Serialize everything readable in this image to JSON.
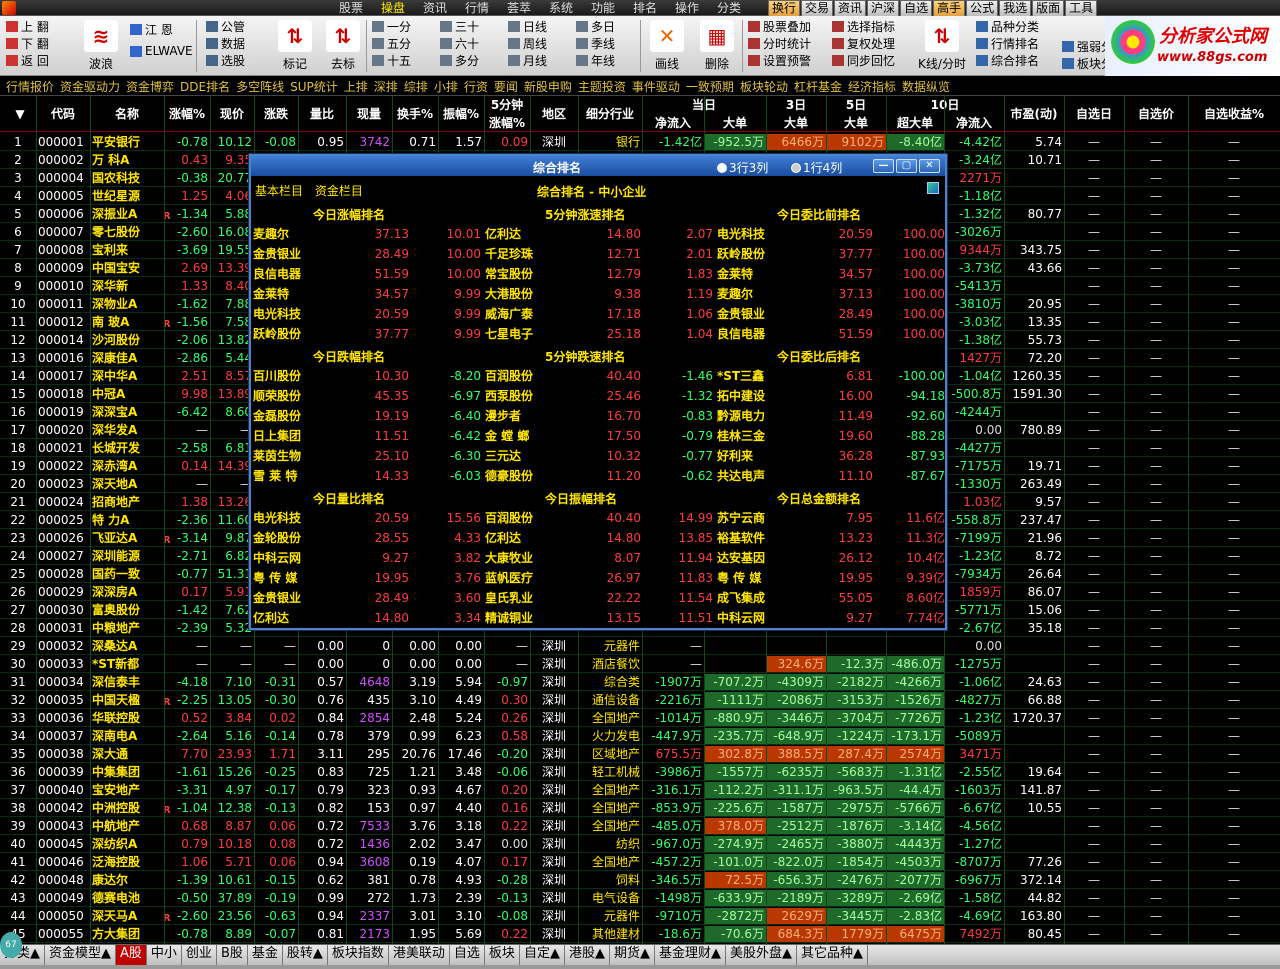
{
  "menu": {
    "items": [
      "股票",
      "操盘",
      "资讯",
      "行情",
      "荟萃",
      "系统",
      "功能",
      "排名",
      "操作",
      "分类"
    ],
    "active": 1,
    "quick": [
      "换行",
      "交易",
      "资讯",
      "沪深",
      "自选",
      "高手",
      "公式",
      "我选",
      "版面",
      "工具"
    ]
  },
  "toolbar": {
    "col1": [
      "上 翻",
      "下 翻",
      "返 回"
    ],
    "big": [
      {
        "label": "波浪",
        "icon": "≋"
      },
      {
        "label": "标记",
        "icon": "⇅"
      },
      {
        "label": "去标",
        "icon": "⇅"
      },
      {
        "label": "画线",
        "icon": "✕"
      },
      {
        "label": "删除",
        "icon": "▦"
      }
    ],
    "elwave": [
      "江 恩",
      "ELWAVE"
    ],
    "col_data": [
      "公管",
      "数据",
      "选股"
    ],
    "periods": [
      [
        "一分",
        "三十",
        "日线",
        "多日"
      ],
      [
        "五分",
        "六十",
        "周线",
        "季线"
      ],
      [
        "十五",
        "多分",
        "月线",
        "年线"
      ]
    ],
    "tools": [
      "股票叠加",
      "分时统计",
      "设置预警"
    ],
    "tools2": [
      "选择指标",
      "复权处理",
      "同步回忆"
    ],
    "kline": "K线/分时",
    "tools3": [
      "品种分类",
      "行情排名",
      "综合排名"
    ],
    "tools4": [
      "强弱分析",
      "板块分析"
    ]
  },
  "logo": {
    "title": "分析家公式网",
    "url": "www.88gs.com"
  },
  "catnav": [
    "行情报价",
    "资金驱动力",
    "资金博弈",
    "DDE排名",
    "多空阵线",
    "SUP统计",
    "上排",
    "深排",
    "综排",
    "小排",
    "行资",
    "要闻",
    "新股申购",
    "主题投资",
    "事件驱动",
    "一致预期",
    "板块轮动",
    "杠杆基金",
    "经济指标",
    "数据纵览"
  ],
  "columns": [
    "代码",
    "名称",
    "涨幅%",
    "现价",
    "涨跌",
    "量比",
    "现量",
    "换手%",
    "振幅%",
    "5分钟涨幅%",
    "地区",
    "细分行业",
    "当日净流入",
    "大单",
    "3日大单",
    "5日大单",
    "10日超大单",
    "10日净流入",
    "市盈(动)",
    "自选日",
    "自选价",
    "自选收益%"
  ],
  "col_groups": {
    "day": "当日",
    "d3": "3日",
    "d5": "5日",
    "d10": "10日",
    "m5a": "5分钟",
    "m5b": "涨幅%",
    "flow": "净流入",
    "big": "大单",
    "xbig": "超大单"
  },
  "rows": [
    [
      "1",
      "000001",
      "平安银行",
      "-0.78",
      "10.12",
      "-0.08",
      "0.95",
      "3742",
      "0.71",
      "1.57",
      "0.09",
      "深圳",
      "银行",
      "-1.42亿",
      "-952.5万",
      "6466万",
      "9102万",
      "-8.40亿",
      "-4.42亿",
      "5.74"
    ],
    [
      "2",
      "000002",
      "万 科A",
      "0.43",
      "9.35",
      "",
      "",
      "",
      "",
      "",
      "",
      "",
      "",
      "",
      "",
      "",
      "",
      "",
      "-3.24亿",
      "10.71"
    ],
    [
      "3",
      "000004",
      "国农科技",
      "-0.38",
      "20.77",
      "",
      "",
      "",
      "",
      "",
      "",
      "",
      "",
      "",
      "",
      "",
      "",
      "",
      "2271万",
      ""
    ],
    [
      "4",
      "000005",
      "世纪星源",
      "1.25",
      "4.06",
      "",
      "",
      "",
      "",
      "",
      "",
      "",
      "",
      "",
      "",
      "",
      "",
      "",
      "-1.18亿",
      ""
    ],
    [
      "5",
      "000006",
      "深振业A",
      "-1.34",
      "5.88",
      "",
      "",
      "",
      "",
      "",
      "",
      "",
      "",
      "",
      "",
      "",
      "",
      "",
      "-1.32亿",
      "80.77"
    ],
    [
      "6",
      "000007",
      "零七股份",
      "-2.60",
      "16.08",
      "",
      "",
      "",
      "",
      "",
      "",
      "",
      "",
      "",
      "",
      "",
      "",
      "",
      "-3026万",
      ""
    ],
    [
      "7",
      "000008",
      "宝利来",
      "-3.69",
      "19.55",
      "",
      "",
      "",
      "",
      "",
      "",
      "",
      "",
      "",
      "",
      "",
      "",
      "",
      "9344万",
      "343.75"
    ],
    [
      "8",
      "000009",
      "中国宝安",
      "2.69",
      "13.39",
      "",
      "",
      "",
      "",
      "",
      "",
      "",
      "",
      "",
      "",
      "",
      "",
      "",
      "-3.73亿",
      "43.66"
    ],
    [
      "9",
      "000010",
      "深华新",
      "1.33",
      "8.40",
      "",
      "",
      "",
      "",
      "",
      "",
      "",
      "",
      "",
      "",
      "",
      "",
      "",
      "-5413万",
      ""
    ],
    [
      "10",
      "000011",
      "深物业A",
      "-1.62",
      "7.88",
      "",
      "",
      "",
      "",
      "",
      "",
      "",
      "",
      "",
      "",
      "",
      "",
      "",
      "-3810万",
      "20.95"
    ],
    [
      "11",
      "000012",
      "南 玻A",
      "-1.56",
      "7.58",
      "",
      "",
      "",
      "",
      "",
      "",
      "",
      "",
      "",
      "",
      "",
      "",
      "",
      "-3.03亿",
      "13.35"
    ],
    [
      "12",
      "000014",
      "沙河股份",
      "-2.06",
      "13.82",
      "",
      "",
      "",
      "",
      "",
      "",
      "",
      "",
      "",
      "",
      "",
      "",
      "",
      "-1.38亿",
      "55.73"
    ],
    [
      "13",
      "000016",
      "深康佳A",
      "-2.86",
      "5.44",
      "",
      "",
      "",
      "",
      "",
      "",
      "",
      "",
      "",
      "",
      "",
      "",
      "",
      "1427万",
      "72.20"
    ],
    [
      "14",
      "000017",
      "深中华A",
      "2.51",
      "8.57",
      "",
      "",
      "",
      "",
      "",
      "",
      "",
      "",
      "",
      "",
      "",
      "",
      "",
      "-1.04亿",
      "1260.35"
    ],
    [
      "15",
      "000018",
      "中冠A",
      "9.98",
      "13.89",
      "",
      "",
      "",
      "",
      "",
      "",
      "",
      "",
      "",
      "",
      "",
      "",
      "",
      "-500.8万",
      "1591.30"
    ],
    [
      "16",
      "000019",
      "深深宝A",
      "-6.42",
      "8.60",
      "",
      "",
      "",
      "",
      "",
      "",
      "",
      "",
      "",
      "",
      "",
      "",
      "",
      "-4244万",
      ""
    ],
    [
      "17",
      "000020",
      "深华发A",
      "—",
      "—",
      "",
      "",
      "",
      "",
      "",
      "",
      "",
      "",
      "",
      "",
      "",
      "",
      "",
      "0.00",
      "780.89"
    ],
    [
      "18",
      "000021",
      "长城开发",
      "-2.58",
      "6.81",
      "",
      "",
      "",
      "",
      "",
      "",
      "",
      "",
      "",
      "",
      "",
      "",
      "",
      "-4427万",
      ""
    ],
    [
      "19",
      "000022",
      "深赤湾A",
      "0.14",
      "14.39",
      "",
      "",
      "",
      "",
      "",
      "",
      "",
      "",
      "",
      "",
      "",
      "",
      "",
      "-7175万",
      "19.71"
    ],
    [
      "20",
      "000023",
      "深天地A",
      "—",
      "—",
      "",
      "",
      "",
      "",
      "",
      "",
      "",
      "",
      "",
      "",
      "",
      "",
      "",
      "-1330万",
      "263.49"
    ],
    [
      "21",
      "000024",
      "招商地产",
      "1.38",
      "13.26",
      "",
      "",
      "",
      "",
      "",
      "",
      "",
      "",
      "",
      "",
      "",
      "",
      "",
      "1.03亿",
      "9.57"
    ],
    [
      "22",
      "000025",
      "特 力A",
      "-2.36",
      "11.60",
      "",
      "",
      "",
      "",
      "",
      "",
      "",
      "",
      "",
      "",
      "",
      "",
      "",
      "-558.8万",
      "237.47"
    ],
    [
      "23",
      "000026",
      "飞亚达A",
      "-3.14",
      "9.87",
      "",
      "",
      "",
      "",
      "",
      "",
      "",
      "",
      "",
      "",
      "",
      "",
      "",
      "-7199万",
      "21.96"
    ],
    [
      "24",
      "000027",
      "深圳能源",
      "-2.71",
      "6.82",
      "",
      "",
      "",
      "",
      "",
      "",
      "",
      "",
      "",
      "",
      "",
      "",
      "",
      "-1.23亿",
      "8.72"
    ],
    [
      "25",
      "000028",
      "国药一致",
      "-0.77",
      "51.31",
      "",
      "",
      "",
      "",
      "",
      "",
      "",
      "",
      "",
      "",
      "",
      "",
      "",
      "-7934万",
      "26.64"
    ],
    [
      "26",
      "000029",
      "深深房A",
      "0.17",
      "5.91",
      "",
      "",
      "",
      "",
      "",
      "",
      "",
      "",
      "",
      "",
      "",
      "",
      "",
      "1859万",
      "86.07"
    ],
    [
      "27",
      "000030",
      "富奥股份",
      "-1.42",
      "7.62",
      "",
      "",
      "",
      "",
      "",
      "",
      "",
      "",
      "",
      "",
      "",
      "",
      "",
      "-5771万",
      "15.06"
    ],
    [
      "28",
      "000031",
      "中粮地产",
      "-2.39",
      "5.32",
      "",
      "",
      "",
      "",
      "",
      "",
      "",
      "",
      "",
      "",
      "",
      "",
      "",
      "-2.67亿",
      "35.18"
    ],
    [
      "29",
      "000032",
      "深桑达A",
      "—",
      "—",
      "—",
      "0.00",
      "0",
      "0.00",
      "0.00",
      "—",
      "深圳",
      "元器件",
      "—",
      "",
      "",
      "",
      "",
      "0.00",
      ""
    ],
    [
      "30",
      "000033",
      "*ST新都",
      "—",
      "—",
      "—",
      "0.00",
      "0",
      "0.00",
      "0.00",
      "—",
      "深圳",
      "酒店餐饮",
      "—",
      "",
      "324.6万",
      "-12.3万",
      "-486.0万",
      "-1275万",
      ""
    ],
    [
      "31",
      "000034",
      "深信泰丰",
      "-4.18",
      "7.10",
      "-0.31",
      "0.57",
      "4648",
      "3.19",
      "5.94",
      "-0.97",
      "深圳",
      "综合类",
      "-1907万",
      "-707.2万",
      "-4309万",
      "-2182万",
      "-4266万",
      "-1.06亿",
      "24.63"
    ],
    [
      "32",
      "000035",
      "中国天楹",
      "-2.25",
      "13.05",
      "-0.30",
      "0.76",
      "435",
      "3.10",
      "4.49",
      "0.30",
      "深圳",
      "通信设备",
      "-2216万",
      "-1111万",
      "-2086万",
      "-3153万",
      "-1526万",
      "-4827万",
      "66.88"
    ],
    [
      "33",
      "000036",
      "华联控股",
      "0.52",
      "3.84",
      "0.02",
      "0.84",
      "2854",
      "2.48",
      "5.24",
      "0.26",
      "深圳",
      "全国地产",
      "-1014万",
      "-880.9万",
      "-3446万",
      "-3704万",
      "-7726万",
      "-1.23亿",
      "1720.37"
    ],
    [
      "34",
      "000037",
      "深南电A",
      "-2.64",
      "5.16",
      "-0.14",
      "0.78",
      "379",
      "0.99",
      "6.23",
      "0.58",
      "深圳",
      "火力发电",
      "-447.9万",
      "-235.7万",
      "-648.9万",
      "-1224万",
      "-173.1万",
      "-5089万",
      ""
    ],
    [
      "35",
      "000038",
      "深大通",
      "7.70",
      "23.93",
      "1.71",
      "3.11",
      "295",
      "20.76",
      "17.46",
      "-0.20",
      "深圳",
      "区域地产",
      "675.5万",
      "302.8万",
      "388.5万",
      "287.4万",
      "2574万",
      "3471万",
      ""
    ],
    [
      "36",
      "000039",
      "中集集团",
      "-1.61",
      "15.26",
      "-0.25",
      "0.83",
      "725",
      "1.21",
      "3.48",
      "-0.06",
      "深圳",
      "轻工机械",
      "-3986万",
      "-1557万",
      "-6235万",
      "-5683万",
      "-1.31亿",
      "-2.55亿",
      "19.64"
    ],
    [
      "37",
      "000040",
      "宝安地产",
      "-3.31",
      "4.97",
      "-0.17",
      "0.79",
      "323",
      "0.93",
      "4.67",
      "0.20",
      "深圳",
      "全国地产",
      "-316.1万",
      "-112.2万",
      "-311.1万",
      "-963.5万",
      "-44.4万",
      "-1603万",
      "141.87"
    ],
    [
      "38",
      "000042",
      "中洲控股",
      "-1.04",
      "12.38",
      "-0.13",
      "0.82",
      "153",
      "0.97",
      "4.40",
      "0.16",
      "深圳",
      "全国地产",
      "-853.9万",
      "-225.6万",
      "-1587万",
      "-2975万",
      "-5766万",
      "-6.67亿",
      "10.55"
    ],
    [
      "39",
      "000043",
      "中航地产",
      "0.68",
      "8.87",
      "0.06",
      "0.72",
      "7533",
      "3.76",
      "3.18",
      "0.22",
      "深圳",
      "全国地产",
      "-485.0万",
      "378.0万",
      "-2512万",
      "-1876万",
      "-3.14亿",
      "-4.56亿",
      ""
    ],
    [
      "40",
      "000045",
      "深纺织A",
      "0.79",
      "10.18",
      "0.08",
      "0.72",
      "1436",
      "2.02",
      "3.47",
      "0.00",
      "深圳",
      "纺织",
      "-967.0万",
      "-274.9万",
      "-2465万",
      "-3880万",
      "-4443万",
      "-1.27亿",
      ""
    ],
    [
      "41",
      "000046",
      "泛海控股",
      "1.06",
      "5.71",
      "0.06",
      "0.94",
      "3608",
      "0.19",
      "4.07",
      "0.17",
      "深圳",
      "全国地产",
      "-457.2万",
      "-101.0万",
      "-822.0万",
      "-1854万",
      "-4503万",
      "-8707万",
      "77.26"
    ],
    [
      "42",
      "000048",
      "康达尔",
      "-1.39",
      "10.61",
      "-0.15",
      "0.62",
      "381",
      "0.78",
      "4.93",
      "-0.28",
      "深圳",
      "饲料",
      "-346.5万",
      "72.5万",
      "-656.3万",
      "-2476万",
      "-2077万",
      "-6967万",
      "372.14"
    ],
    [
      "43",
      "000049",
      "德赛电池",
      "-0.50",
      "37.89",
      "-0.19",
      "0.99",
      "272",
      "1.73",
      "2.39",
      "-0.13",
      "深圳",
      "电气设备",
      "-1498万",
      "-633.9万",
      "-2189万",
      "-3289万",
      "-2.69亿",
      "-1.58亿",
      "44.82"
    ],
    [
      "44",
      "000050",
      "深天马A",
      "-2.60",
      "23.56",
      "-0.63",
      "0.94",
      "2337",
      "3.01",
      "3.10",
      "-0.08",
      "深圳",
      "元器件",
      "-9710万",
      "-2872万",
      "2629万",
      "-3445万",
      "-2.83亿",
      "-4.69亿",
      "163.80"
    ],
    [
      "45",
      "000055",
      "方大集团",
      "-0.78",
      "8.89",
      "-0.07",
      "0.81",
      "2173",
      "1.95",
      "5.69",
      "0.22",
      "深圳",
      "其他建材",
      "-18.6万",
      "-70.6万",
      "684.3万",
      "1779万",
      "6475万",
      "7492万",
      "80.45"
    ]
  ],
  "dialog": {
    "title": "综合排名",
    "opt1": "3行3列",
    "opt2": "1行4列",
    "tab1": "基本栏目",
    "tab2": "资金栏目",
    "subtitle": "综合排名 - 中小企业",
    "sections": [
      {
        "title": "今日涨幅排名",
        "items": [
          [
            "麦趣尔",
            "37.13",
            "10.01"
          ],
          [
            "金贵银业",
            "28.49",
            "10.00"
          ],
          [
            "良信电器",
            "51.59",
            "10.00"
          ],
          [
            "金莱特",
            "34.57",
            "9.99"
          ],
          [
            "电光科技",
            "20.59",
            "9.99"
          ],
          [
            "跃岭股份",
            "37.77",
            "9.99"
          ]
        ]
      },
      {
        "title": "5分钟涨速排名",
        "items": [
          [
            "亿利达",
            "14.80",
            "2.07"
          ],
          [
            "千足珍珠",
            "12.71",
            "2.01"
          ],
          [
            "常宝股份",
            "12.79",
            "1.83"
          ],
          [
            "大港股份",
            "9.38",
            "1.19"
          ],
          [
            "威海广泰",
            "17.18",
            "1.06"
          ],
          [
            "七星电子",
            "25.18",
            "1.04"
          ]
        ]
      },
      {
        "title": "今日委比前排名",
        "items": [
          [
            "电光科技",
            "20.59",
            "100.00"
          ],
          [
            "跃岭股份",
            "37.77",
            "100.00"
          ],
          [
            "金莱特",
            "34.57",
            "100.00"
          ],
          [
            "麦趣尔",
            "37.13",
            "100.00"
          ],
          [
            "金贵银业",
            "28.49",
            "100.00"
          ],
          [
            "良信电器",
            "51.59",
            "100.00"
          ]
        ]
      },
      {
        "title": "今日跌幅排名",
        "items": [
          [
            "百川股份",
            "10.30",
            "-8.20"
          ],
          [
            "顺荣股份",
            "45.35",
            "-6.97"
          ],
          [
            "金磊股份",
            "19.19",
            "-6.40"
          ],
          [
            "日上集团",
            "11.51",
            "-6.42"
          ],
          [
            "莱茵生物",
            "25.10",
            "-6.30"
          ],
          [
            "雪 莱 特",
            "14.33",
            "-6.03"
          ]
        ]
      },
      {
        "title": "5分钟跌速排名",
        "items": [
          [
            "百润股份",
            "40.40",
            "-1.46"
          ],
          [
            "西泵股份",
            "25.46",
            "-1.32"
          ],
          [
            "漫步者",
            "16.70",
            "-0.83"
          ],
          [
            "金 螳 螂",
            "17.50",
            "-0.79"
          ],
          [
            "三元达",
            "10.32",
            "-0.77"
          ],
          [
            "德豪股份",
            "11.20",
            "-0.62"
          ]
        ]
      },
      {
        "title": "今日委比后排名",
        "items": [
          [
            "*ST三鑫",
            "6.81",
            "-100.00"
          ],
          [
            "拓中建设",
            "16.00",
            "-94.18"
          ],
          [
            "黔源电力",
            "11.49",
            "-92.60"
          ],
          [
            "桂林三金",
            "19.60",
            "-88.28"
          ],
          [
            "好利来",
            "36.28",
            "-87.93"
          ],
          [
            "共达电声",
            "11.10",
            "-87.67"
          ]
        ]
      },
      {
        "title": "今日量比排名",
        "items": [
          [
            "电光科技",
            "20.59",
            "15.56"
          ],
          [
            "金轮股份",
            "28.55",
            "4.33"
          ],
          [
            "中科云网",
            "9.27",
            "3.82"
          ],
          [
            "粤 传 媒",
            "19.95",
            "3.76"
          ],
          [
            "金贵银业",
            "28.49",
            "3.60"
          ],
          [
            "亿利达",
            "14.80",
            "3.34"
          ]
        ]
      },
      {
        "title": "今日振幅排名",
        "items": [
          [
            "百润股份",
            "40.40",
            "14.99"
          ],
          [
            "亿利达",
            "14.80",
            "13.85"
          ],
          [
            "大康牧业",
            "8.07",
            "11.94"
          ],
          [
            "蓝帆医疗",
            "26.97",
            "11.83"
          ],
          [
            "皇氏乳业",
            "22.22",
            "11.54"
          ],
          [
            "精诚铜业",
            "13.15",
            "11.51"
          ]
        ]
      },
      {
        "title": "今日总金额排名",
        "items": [
          [
            "苏宁云商",
            "7.95",
            "11.6亿"
          ],
          [
            "裕基软件",
            "13.23",
            "11.3亿"
          ],
          [
            "达安基因",
            "26.12",
            "10.4亿"
          ],
          [
            "粤 传 媒",
            "19.95",
            "9.39亿"
          ],
          [
            "成飞集成",
            "55.05",
            "8.60亿"
          ],
          [
            "中科云网",
            "9.27",
            "7.74亿"
          ]
        ]
      }
    ]
  },
  "bottom_tabs": [
    "分类▲",
    "资金模型▲",
    "A股",
    "中小",
    "创业",
    "B股",
    "基金",
    "股转▲",
    "板块指数",
    "港美联动",
    "自选",
    "板块",
    "自定▲",
    "港股▲",
    "期货▲",
    "基金理财▲",
    "美股外盘▲",
    "其它品种▲"
  ],
  "bottom_active": 2,
  "colors": {
    "up": "#ff3c3c",
    "down": "#33ff66",
    "accent": "#ffe600",
    "grid": "#0a4a1a"
  }
}
